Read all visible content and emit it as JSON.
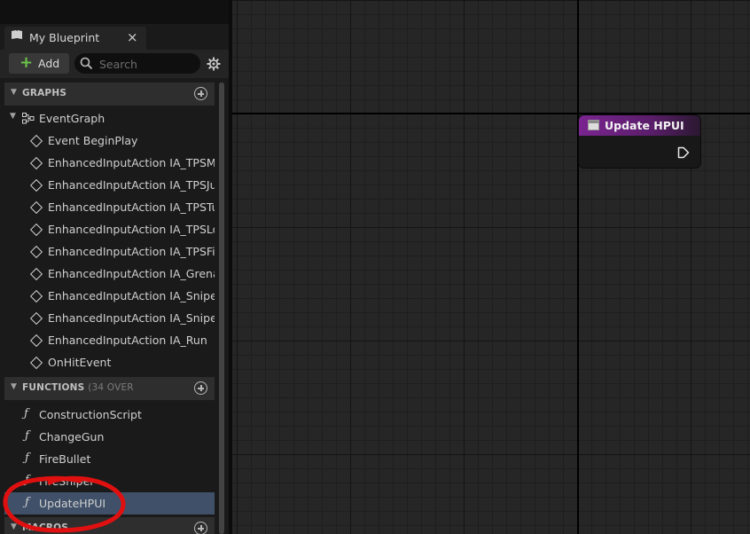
{
  "panel": {
    "tab_title": "My Blueprint",
    "tab_close": "×",
    "add_label": "Add",
    "search_placeholder": "Search"
  },
  "graphs": {
    "header": "GRAPHS",
    "event_graph": "EventGraph",
    "events": [
      "Event BeginPlay",
      "EnhancedInputAction IA_TPSMove",
      "EnhancedInputAction IA_TPSJump",
      "EnhancedInputAction IA_TPSTurn",
      "EnhancedInputAction IA_TPSLookUp",
      "EnhancedInputAction IA_TPSFire",
      "EnhancedInputAction IA_GrenadeGun",
      "EnhancedInputAction IA_SniperGun",
      "EnhancedInputAction IA_SniperScope",
      "EnhancedInputAction IA_Run",
      "OnHitEvent"
    ]
  },
  "functions": {
    "header": "FUNCTIONS",
    "header_note": "(34 OVER",
    "items": [
      "ConstructionScript",
      "ChangeGun",
      "FireBullet",
      "FireSniper",
      "UpdateHPUI"
    ],
    "selected": "UpdateHPUI"
  },
  "macros": {
    "header": "MACROS"
  },
  "graph_node": {
    "title": "Update HPUI",
    "header_color": "#7a2590"
  },
  "colors": {
    "add_plus": "#6cc44a",
    "selected_row": "#3f5068",
    "annotation": "#e01010"
  }
}
